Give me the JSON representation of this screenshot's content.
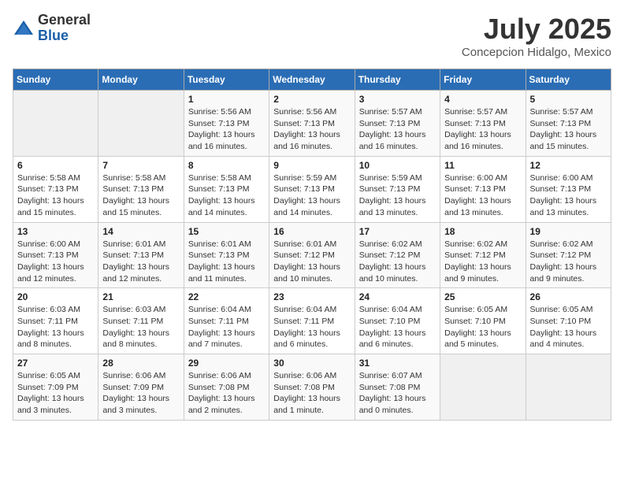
{
  "header": {
    "logo_general": "General",
    "logo_blue": "Blue",
    "month_year": "July 2025",
    "location": "Concepcion Hidalgo, Mexico"
  },
  "days_of_week": [
    "Sunday",
    "Monday",
    "Tuesday",
    "Wednesday",
    "Thursday",
    "Friday",
    "Saturday"
  ],
  "weeks": [
    [
      {
        "day": "",
        "detail": ""
      },
      {
        "day": "",
        "detail": ""
      },
      {
        "day": "1",
        "detail": "Sunrise: 5:56 AM\nSunset: 7:13 PM\nDaylight: 13 hours\nand 16 minutes."
      },
      {
        "day": "2",
        "detail": "Sunrise: 5:56 AM\nSunset: 7:13 PM\nDaylight: 13 hours\nand 16 minutes."
      },
      {
        "day": "3",
        "detail": "Sunrise: 5:57 AM\nSunset: 7:13 PM\nDaylight: 13 hours\nand 16 minutes."
      },
      {
        "day": "4",
        "detail": "Sunrise: 5:57 AM\nSunset: 7:13 PM\nDaylight: 13 hours\nand 16 minutes."
      },
      {
        "day": "5",
        "detail": "Sunrise: 5:57 AM\nSunset: 7:13 PM\nDaylight: 13 hours\nand 15 minutes."
      }
    ],
    [
      {
        "day": "6",
        "detail": "Sunrise: 5:58 AM\nSunset: 7:13 PM\nDaylight: 13 hours\nand 15 minutes."
      },
      {
        "day": "7",
        "detail": "Sunrise: 5:58 AM\nSunset: 7:13 PM\nDaylight: 13 hours\nand 15 minutes."
      },
      {
        "day": "8",
        "detail": "Sunrise: 5:58 AM\nSunset: 7:13 PM\nDaylight: 13 hours\nand 14 minutes."
      },
      {
        "day": "9",
        "detail": "Sunrise: 5:59 AM\nSunset: 7:13 PM\nDaylight: 13 hours\nand 14 minutes."
      },
      {
        "day": "10",
        "detail": "Sunrise: 5:59 AM\nSunset: 7:13 PM\nDaylight: 13 hours\nand 13 minutes."
      },
      {
        "day": "11",
        "detail": "Sunrise: 6:00 AM\nSunset: 7:13 PM\nDaylight: 13 hours\nand 13 minutes."
      },
      {
        "day": "12",
        "detail": "Sunrise: 6:00 AM\nSunset: 7:13 PM\nDaylight: 13 hours\nand 13 minutes."
      }
    ],
    [
      {
        "day": "13",
        "detail": "Sunrise: 6:00 AM\nSunset: 7:13 PM\nDaylight: 13 hours\nand 12 minutes."
      },
      {
        "day": "14",
        "detail": "Sunrise: 6:01 AM\nSunset: 7:13 PM\nDaylight: 13 hours\nand 12 minutes."
      },
      {
        "day": "15",
        "detail": "Sunrise: 6:01 AM\nSunset: 7:13 PM\nDaylight: 13 hours\nand 11 minutes."
      },
      {
        "day": "16",
        "detail": "Sunrise: 6:01 AM\nSunset: 7:12 PM\nDaylight: 13 hours\nand 10 minutes."
      },
      {
        "day": "17",
        "detail": "Sunrise: 6:02 AM\nSunset: 7:12 PM\nDaylight: 13 hours\nand 10 minutes."
      },
      {
        "day": "18",
        "detail": "Sunrise: 6:02 AM\nSunset: 7:12 PM\nDaylight: 13 hours\nand 9 minutes."
      },
      {
        "day": "19",
        "detail": "Sunrise: 6:02 AM\nSunset: 7:12 PM\nDaylight: 13 hours\nand 9 minutes."
      }
    ],
    [
      {
        "day": "20",
        "detail": "Sunrise: 6:03 AM\nSunset: 7:11 PM\nDaylight: 13 hours\nand 8 minutes."
      },
      {
        "day": "21",
        "detail": "Sunrise: 6:03 AM\nSunset: 7:11 PM\nDaylight: 13 hours\nand 8 minutes."
      },
      {
        "day": "22",
        "detail": "Sunrise: 6:04 AM\nSunset: 7:11 PM\nDaylight: 13 hours\nand 7 minutes."
      },
      {
        "day": "23",
        "detail": "Sunrise: 6:04 AM\nSunset: 7:11 PM\nDaylight: 13 hours\nand 6 minutes."
      },
      {
        "day": "24",
        "detail": "Sunrise: 6:04 AM\nSunset: 7:10 PM\nDaylight: 13 hours\nand 6 minutes."
      },
      {
        "day": "25",
        "detail": "Sunrise: 6:05 AM\nSunset: 7:10 PM\nDaylight: 13 hours\nand 5 minutes."
      },
      {
        "day": "26",
        "detail": "Sunrise: 6:05 AM\nSunset: 7:10 PM\nDaylight: 13 hours\nand 4 minutes."
      }
    ],
    [
      {
        "day": "27",
        "detail": "Sunrise: 6:05 AM\nSunset: 7:09 PM\nDaylight: 13 hours\nand 3 minutes."
      },
      {
        "day": "28",
        "detail": "Sunrise: 6:06 AM\nSunset: 7:09 PM\nDaylight: 13 hours\nand 3 minutes."
      },
      {
        "day": "29",
        "detail": "Sunrise: 6:06 AM\nSunset: 7:08 PM\nDaylight: 13 hours\nand 2 minutes."
      },
      {
        "day": "30",
        "detail": "Sunrise: 6:06 AM\nSunset: 7:08 PM\nDaylight: 13 hours\nand 1 minute."
      },
      {
        "day": "31",
        "detail": "Sunrise: 6:07 AM\nSunset: 7:08 PM\nDaylight: 13 hours\nand 0 minutes."
      },
      {
        "day": "",
        "detail": ""
      },
      {
        "day": "",
        "detail": ""
      }
    ]
  ]
}
